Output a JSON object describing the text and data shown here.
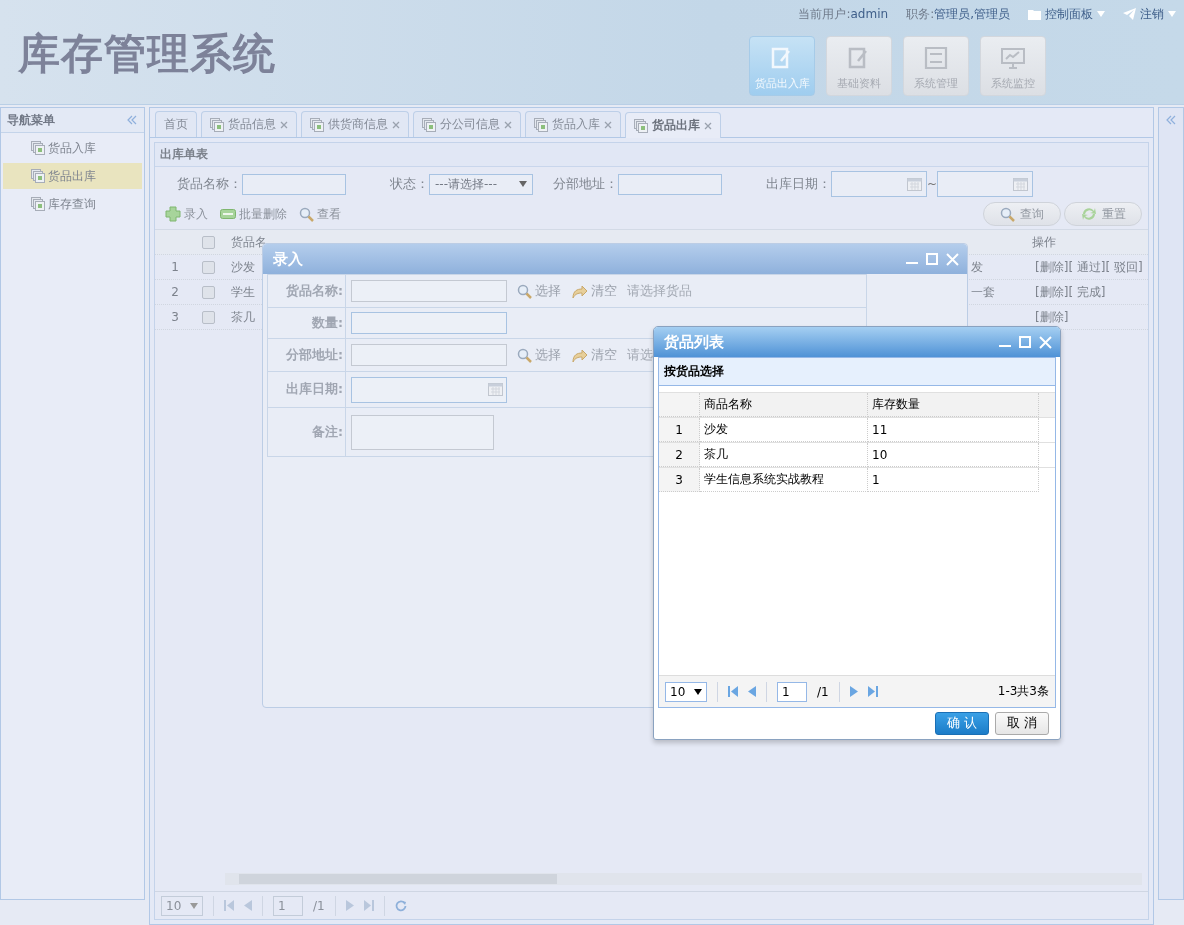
{
  "header": {
    "title": "库存管理系统",
    "user_label": "当前用户:",
    "user": "admin",
    "role_label": "职务:",
    "role": "管理员,管理员",
    "control_panel": "控制面板",
    "logout": "注销",
    "modules": [
      {
        "label": "货品出入库",
        "selected": true
      },
      {
        "label": "基础资料",
        "selected": false
      },
      {
        "label": "系统管理",
        "selected": false
      },
      {
        "label": "系统监控",
        "selected": false
      }
    ]
  },
  "sidebar": {
    "title": "导航菜单",
    "items": [
      {
        "label": "货品入库",
        "selected": false
      },
      {
        "label": "货品出库",
        "selected": true
      },
      {
        "label": "库存查询",
        "selected": false
      }
    ]
  },
  "tabs": [
    {
      "label": "首页",
      "closable": false,
      "selected": false
    },
    {
      "label": "货品信息",
      "closable": true,
      "selected": false
    },
    {
      "label": "供货商信息",
      "closable": true,
      "selected": false
    },
    {
      "label": "分公司信息",
      "closable": true,
      "selected": false
    },
    {
      "label": "货品入库",
      "closable": true,
      "selected": false
    },
    {
      "label": "货品出库",
      "closable": true,
      "selected": true
    }
  ],
  "panel": {
    "title": "出库单表",
    "filters": [
      {
        "label": "货品名称：",
        "kind": "text"
      },
      {
        "label": "状态：",
        "kind": "select",
        "value": "---请选择---"
      },
      {
        "label": "分部地址：",
        "kind": "text"
      },
      {
        "label": "出库日期：",
        "kind": "daterange",
        "separator": "~"
      }
    ],
    "toolbar": [
      {
        "label": "录入",
        "kind": "add"
      },
      {
        "label": "批量删除",
        "kind": "remove"
      },
      {
        "label": "查看",
        "kind": "view"
      }
    ],
    "buttons": [
      {
        "label": "查询",
        "kind": "search"
      },
      {
        "label": "重置",
        "kind": "reset"
      }
    ],
    "table": {
      "name_column": "货品名",
      "action_column": "操作",
      "all_checked": false,
      "rows": [
        {
          "no": "1",
          "name": "沙发",
          "checked": false,
          "note": "发",
          "actions": [
            "[删除]",
            "[ 通过]",
            "[ 驳回]"
          ]
        },
        {
          "no": "2",
          "name": "学生",
          "checked": false,
          "note": "一套",
          "actions": [
            "[删除]",
            "[ 完成]"
          ]
        },
        {
          "no": "3",
          "name": "茶几",
          "checked": false,
          "actions": [
            "[删除]"
          ]
        }
      ]
    },
    "pager": {
      "page_size": "10",
      "page": "1",
      "total_pages": "/1"
    }
  },
  "entry_dialog": {
    "title": "录入",
    "fields": [
      {
        "label": "货品名称:",
        "kind": "pick",
        "select": "选择",
        "clear": "清空",
        "hint": "请选择货品"
      },
      {
        "label": "数量:",
        "kind": "text"
      },
      {
        "label": "分部地址:",
        "kind": "pick",
        "select": "选择",
        "clear": "清空",
        "hint": "请选"
      },
      {
        "label": "出库日期:",
        "kind": "date"
      },
      {
        "label": "备注:",
        "kind": "textarea"
      }
    ]
  },
  "goods_dialog": {
    "title": "货品列表",
    "section": "按货品选择",
    "columns": [
      "商品名称",
      "库存数量"
    ],
    "rows": [
      {
        "no": "1",
        "name": "沙发",
        "qty": "11"
      },
      {
        "no": "2",
        "name": "茶几",
        "qty": "10"
      },
      {
        "no": "3",
        "name": "学生信息系统实战教程",
        "qty": "1"
      }
    ],
    "pager": {
      "page_size": "10",
      "page": "1",
      "total_pages": "/1",
      "summary": "1-3共3条"
    },
    "buttons": [
      {
        "label": "确认",
        "kind": "primary"
      },
      {
        "label": "取消",
        "kind": "default"
      }
    ]
  }
}
